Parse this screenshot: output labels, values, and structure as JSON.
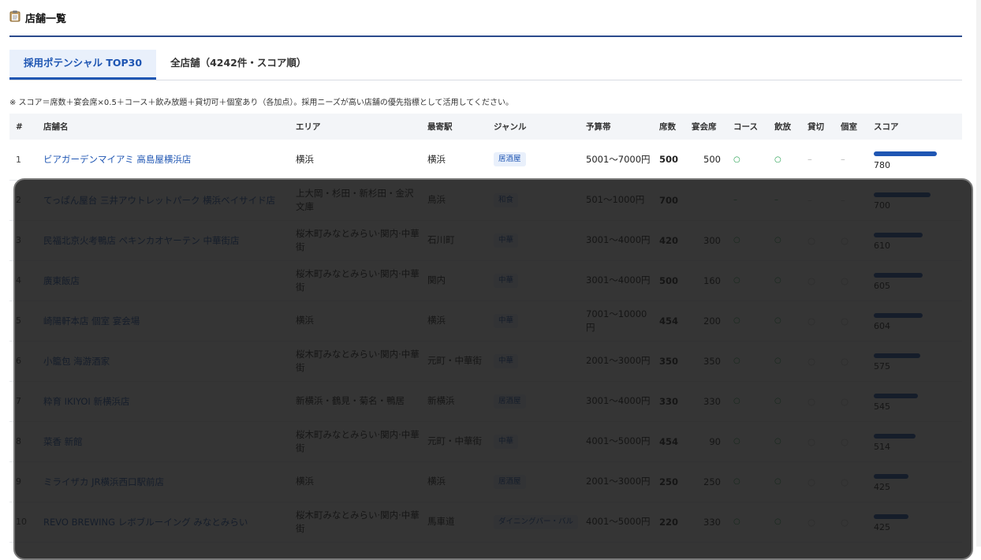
{
  "header": {
    "icon": "clipboard-icon",
    "title": "店舗一覧"
  },
  "tabs": [
    {
      "label": "採用ポテンシャル TOP30",
      "active": true
    },
    {
      "label": "全店舗（4242件・スコア順）",
      "active": false
    }
  ],
  "note": "※ スコア＝席数＋宴会席×0.5＋コース＋飲み放題＋貸切可＋個室あり（各加点）。採用ニーズが高い店舗の優先指標として活用してください。",
  "columns": [
    "#",
    "店舗名",
    "エリア",
    "最寄駅",
    "ジャンル",
    "予算帯",
    "席数",
    "宴会席",
    "コース",
    "飲放",
    "貸切",
    "個室",
    "スコア"
  ],
  "rows": [
    {
      "no": "1",
      "name": "ビアガーデンマイアミ 高島屋横浜店",
      "area": "横浜",
      "station": "横浜",
      "genre": "居酒屋",
      "budget": "5001〜7000円",
      "seats": "500",
      "banquet": "500",
      "course": "○",
      "drink": "○",
      "private": "–",
      "room": "–",
      "score": "780",
      "score_pct": 1.0
    },
    {
      "no": "2",
      "name": "てっぱん屋台 三井アウトレットパーク 横浜ベイサイド店",
      "area": "上大岡・杉田・新杉田・金沢文庫",
      "station": "鳥浜",
      "genre": "和食",
      "budget": "501〜1000円",
      "seats": "700",
      "banquet": "",
      "course": "–",
      "drink": "–",
      "private": "–",
      "room": "–",
      "score": "700",
      "score_pct": 0.9
    },
    {
      "no": "3",
      "name": "民福北京火考鴨店 ペキンカオヤーテン 中華街店",
      "area": "桜木町みなとみらい·関内·中華街",
      "station": "石川町",
      "genre": "中華",
      "budget": "3001〜4000円",
      "seats": "420",
      "banquet": "300",
      "course": "○",
      "drink": "○",
      "private": "○",
      "room": "○",
      "score": "610",
      "score_pct": 0.78
    },
    {
      "no": "4",
      "name": "廣東飯店",
      "area": "桜木町みなとみらい·関内·中華街",
      "station": "関内",
      "genre": "中華",
      "budget": "3001〜4000円",
      "seats": "500",
      "banquet": "160",
      "course": "○",
      "drink": "○",
      "private": "○",
      "room": "○",
      "score": "605",
      "score_pct": 0.78
    },
    {
      "no": "5",
      "name": "崎陽軒本店 個室 宴会場",
      "area": "横浜",
      "station": "横浜",
      "genre": "中華",
      "budget": "7001〜10000円",
      "seats": "454",
      "banquet": "200",
      "course": "○",
      "drink": "○",
      "private": "○",
      "room": "○",
      "score": "604",
      "score_pct": 0.77
    },
    {
      "no": "6",
      "name": "小籠包 海游酒家",
      "area": "桜木町みなとみらい·関内·中華街",
      "station": "元町・中華街",
      "genre": "中華",
      "budget": "2001〜3000円",
      "seats": "350",
      "banquet": "350",
      "course": "○",
      "drink": "○",
      "private": "○",
      "room": "○",
      "score": "575",
      "score_pct": 0.74
    },
    {
      "no": "7",
      "name": "粋育 IKIYOI 新横浜店",
      "area": "新横浜・鶴見・菊名・鴨居",
      "station": "新横浜",
      "genre": "居酒屋",
      "budget": "3001〜4000円",
      "seats": "330",
      "banquet": "330",
      "course": "○",
      "drink": "○",
      "private": "○",
      "room": "○",
      "score": "545",
      "score_pct": 0.7
    },
    {
      "no": "8",
      "name": "菜香 新館",
      "area": "桜木町みなとみらい·関内·中華街",
      "station": "元町・中華街",
      "genre": "中華",
      "budget": "4001〜5000円",
      "seats": "454",
      "banquet": "90",
      "course": "○",
      "drink": "○",
      "private": "○",
      "room": "○",
      "score": "514",
      "score_pct": 0.66
    },
    {
      "no": "9",
      "name": "ミライザカ JR横浜西口駅前店",
      "area": "横浜",
      "station": "横浜",
      "genre": "居酒屋",
      "budget": "2001〜3000円",
      "seats": "250",
      "banquet": "250",
      "course": "○",
      "drink": "○",
      "private": "○",
      "room": "○",
      "score": "425",
      "score_pct": 0.55
    },
    {
      "no": "10",
      "name": "REVO BREWING レボブルーイング みなとみらい",
      "area": "桜木町みなとみらい·関内·中華街",
      "station": "馬車道",
      "genre": "ダイニングバー・バル",
      "budget": "4001〜5000円",
      "seats": "220",
      "banquet": "330",
      "course": "○",
      "drink": "○",
      "private": "○",
      "room": "○",
      "score": "425",
      "score_pct": 0.55
    }
  ]
}
